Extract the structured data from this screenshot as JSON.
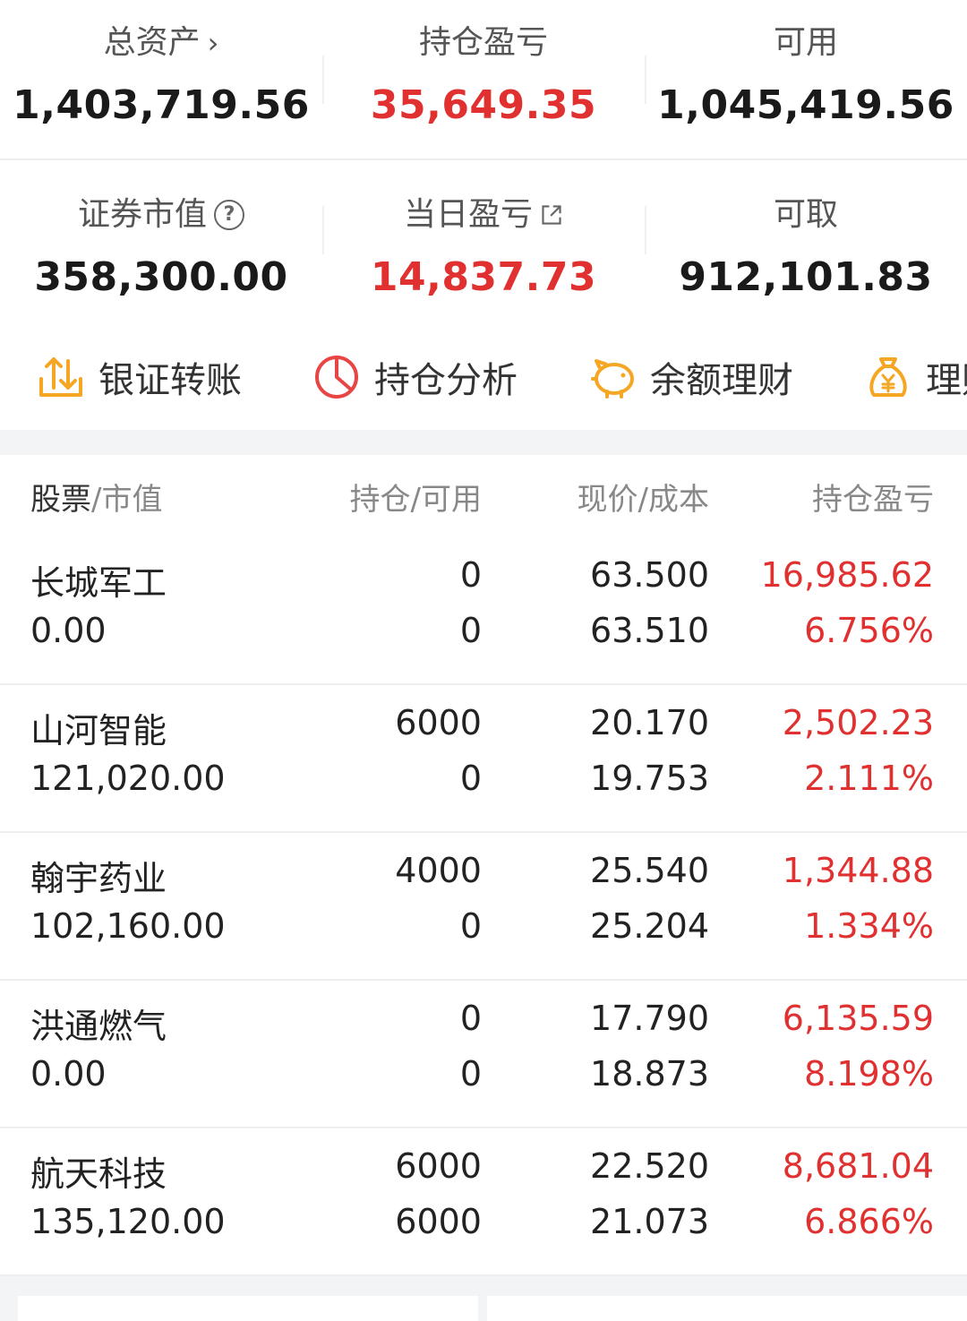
{
  "summary": {
    "total_assets": {
      "label": "总资产",
      "value": "1,403,719.56"
    },
    "position_pl": {
      "label": "持仓盈亏",
      "value": "35,649.35"
    },
    "available": {
      "label": "可用",
      "value": "1,045,419.56"
    },
    "market_value": {
      "label": "证券市值",
      "value": "358,300.00"
    },
    "daily_pl": {
      "label": "当日盈亏",
      "value": "14,837.73"
    },
    "withdrawable": {
      "label": "可取",
      "value": "912,101.83"
    }
  },
  "quick_actions": [
    {
      "label": "银证转账",
      "icon": "transfer-icon"
    },
    {
      "label": "持仓分析",
      "icon": "pie-chart-icon"
    },
    {
      "label": "余额理财",
      "icon": "piggy-bank-icon"
    },
    {
      "label": "理财",
      "icon": "money-bag-icon"
    }
  ],
  "table": {
    "headers": {
      "c1a": "股票",
      "c1b": "市值",
      "c2a": "持仓",
      "c2b": "可用",
      "c3a": "现价",
      "c3b": "成本",
      "c4": "持仓盈亏"
    },
    "rows": [
      {
        "name": "长城军工",
        "market_value": "0.00",
        "position": "0",
        "available": "0",
        "price": "63.500",
        "cost": "63.510",
        "pl": "16,985.62",
        "pl_pct": "6.756%"
      },
      {
        "name": "山河智能",
        "market_value": "121,020.00",
        "position": "6000",
        "available": "0",
        "price": "20.170",
        "cost": "19.753",
        "pl": "2,502.23",
        "pl_pct": "2.111%"
      },
      {
        "name": "翰宇药业",
        "market_value": "102,160.00",
        "position": "4000",
        "available": "0",
        "price": "25.540",
        "cost": "25.204",
        "pl": "1,344.88",
        "pl_pct": "1.334%"
      },
      {
        "name": "洪通燃气",
        "market_value": "0.00",
        "position": "0",
        "available": "0",
        "price": "17.790",
        "cost": "18.873",
        "pl": "6,135.59",
        "pl_pct": "8.198%"
      },
      {
        "name": "航天科技",
        "market_value": "135,120.00",
        "position": "6000",
        "available": "6000",
        "price": "22.520",
        "cost": "21.073",
        "pl": "8,681.04",
        "pl_pct": "6.866%"
      }
    ]
  },
  "colors": {
    "profit": "#e03030",
    "accent_orange": "#f5a623",
    "accent_red": "#e84545"
  }
}
